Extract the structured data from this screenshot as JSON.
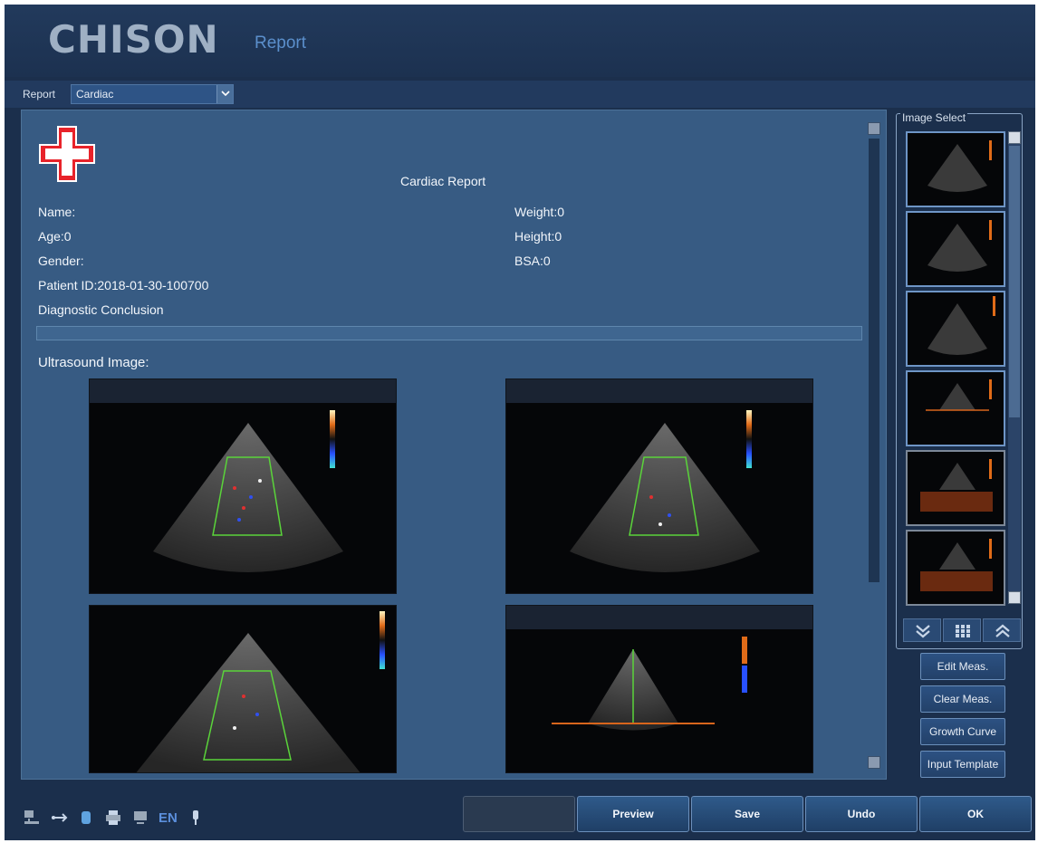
{
  "header": {
    "logo_text": "CHISON",
    "title": "Report"
  },
  "report_select": {
    "label": "Report",
    "value": "Cardiac"
  },
  "report": {
    "title": "Cardiac Report",
    "name": "Name:",
    "age": "Age:0",
    "gender": "Gender:",
    "patient_id": "Patient ID:2018-01-30-100700",
    "weight": "Weight:0",
    "height": "Height:0",
    "bsa": "BSA:0",
    "diagnostic_conclusion": "Diagnostic Conclusion",
    "diagnostic_text": "",
    "ultrasound_image_label": "Ultrasound Image:"
  },
  "image_select": {
    "label": "Image Select"
  },
  "side_buttons": {
    "edit_meas": "Edit Meas.",
    "clear_meas": "Clear Meas.",
    "growth_curve": "Growth Curve",
    "input_template": "Input Template"
  },
  "bottom_buttons": {
    "blank": "",
    "preview": "Preview",
    "save": "Save",
    "undo": "Undo",
    "ok": "OK"
  },
  "status_bar": {
    "language": "EN"
  },
  "colors": {
    "background": "#1b2f4c",
    "report_panel": "#375b83",
    "logo": "#9fb0c4",
    "title": "#5b8fcc",
    "hospital_cross": "#e8232a"
  }
}
